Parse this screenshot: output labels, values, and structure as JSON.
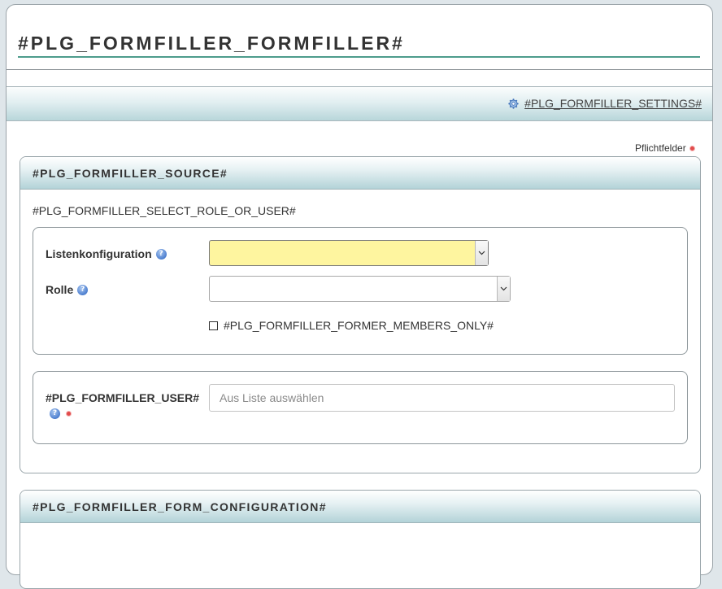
{
  "page": {
    "title": "#PLG_FORMFILLER_FORMFILLER#",
    "settings_link": "#PLG_FORMFILLER_SETTINGS#",
    "required_note": "Pflichtfelder"
  },
  "source_panel": {
    "title": "#PLG_FORMFILLER_SOURCE#",
    "description": "#PLG_FORMFILLER_SELECT_ROLE_OR_USER#",
    "list_config_label": "Listenkonfiguration",
    "list_config_value": "",
    "role_label": "Rolle",
    "role_value": "",
    "former_members_label": "#PLG_FORMFILLER_FORMER_MEMBERS_ONLY#",
    "former_members_checked": false,
    "user_label": "#PLG_FORMFILLER_USER#",
    "user_placeholder": "Aus Liste auswählen"
  },
  "form_config_panel": {
    "title": "#PLG_FORMFILLER_FORM_CONFIGURATION#"
  },
  "icons": {
    "settings": "gear-icon",
    "help": "help-icon",
    "required": "required-dot",
    "dropdown": "chevron-down-icon"
  },
  "colors": {
    "title_underline": "#4d9c8c",
    "highlight_select": "#fef59f",
    "required_dot": "#e24b4b",
    "help_icon": "#4d7fcf"
  }
}
